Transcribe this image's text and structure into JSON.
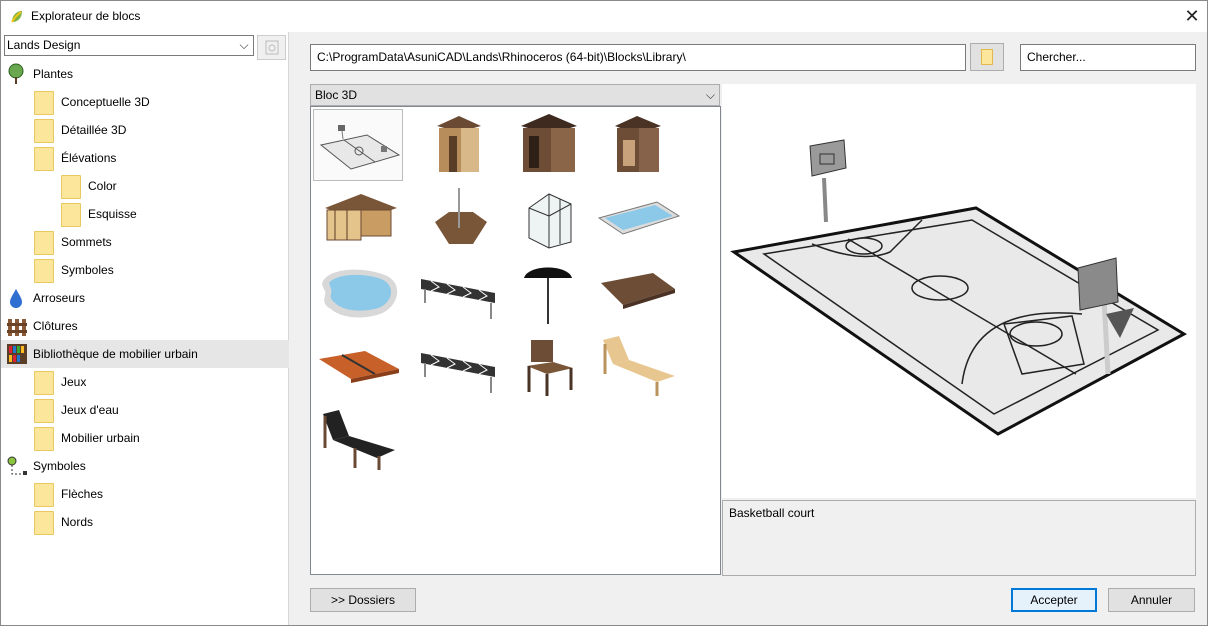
{
  "window": {
    "title": "Explorateur de blocs",
    "close_glyph": "✕"
  },
  "left": {
    "library_select": "Lands Design",
    "tree": [
      {
        "label": "Plantes",
        "icon": "tree-icon",
        "level": 0
      },
      {
        "label": "Conceptuelle 3D",
        "icon": "folder-icon",
        "level": 1
      },
      {
        "label": "Détaillée 3D",
        "icon": "folder-icon",
        "level": 1
      },
      {
        "label": "Élévations",
        "icon": "folder-icon",
        "level": 1
      },
      {
        "label": "Color",
        "icon": "folder-icon",
        "level": 2
      },
      {
        "label": "Esquisse",
        "icon": "folder-icon",
        "level": 2
      },
      {
        "label": "Sommets",
        "icon": "folder-icon",
        "level": 1
      },
      {
        "label": "Symboles",
        "icon": "folder-icon",
        "level": 1
      },
      {
        "label": "Arroseurs",
        "icon": "water-drop-icon",
        "level": 0
      },
      {
        "label": "Clôtures",
        "icon": "fence-icon",
        "level": 0
      },
      {
        "label": "Bibliothèque de mobilier urbain",
        "icon": "bookshelf-icon",
        "level": 0,
        "selected": true
      },
      {
        "label": "Jeux",
        "icon": "folder-icon",
        "level": 1
      },
      {
        "label": "Jeux d'eau",
        "icon": "folder-icon",
        "level": 1
      },
      {
        "label": "Mobilier urbain",
        "icon": "folder-icon",
        "level": 1
      },
      {
        "label": "Symboles",
        "icon": "symbol-icon",
        "level": 0
      },
      {
        "label": "Flèches",
        "icon": "folder-icon",
        "level": 1
      },
      {
        "label": "Nords",
        "icon": "folder-icon",
        "level": 1
      }
    ]
  },
  "toolbar": {
    "path": "C:\\ProgramData\\AsuniCAD\\Lands\\Rhinoceros (64-bit)\\Blocks\\Library\\",
    "search_placeholder": "Chercher..."
  },
  "blocks": {
    "category": "Bloc 3D",
    "items": [
      {
        "name": "basketball-court",
        "selected": true
      },
      {
        "name": "wood-shed-light"
      },
      {
        "name": "wood-shed-dark"
      },
      {
        "name": "wood-shed-open"
      },
      {
        "name": "timber-pavilion"
      },
      {
        "name": "hexagonal-deck"
      },
      {
        "name": "greenhouse"
      },
      {
        "name": "rectangular-pool"
      },
      {
        "name": "kidney-pool"
      },
      {
        "name": "bike-rack"
      },
      {
        "name": "umbrella"
      },
      {
        "name": "wood-deck"
      },
      {
        "name": "ping-pong-table"
      },
      {
        "name": "bike-rack-2"
      },
      {
        "name": "wood-armchair"
      },
      {
        "name": "wood-lounger"
      },
      {
        "name": "dark-lounger"
      }
    ]
  },
  "preview": {
    "description": "Basketball court"
  },
  "buttons": {
    "folders": ">> Dossiers",
    "accept": "Accepter",
    "cancel": "Annuler"
  },
  "colors": {
    "selection": "#e6e6e6",
    "folder": "#fce69b",
    "primary_border": "#0078d7"
  }
}
